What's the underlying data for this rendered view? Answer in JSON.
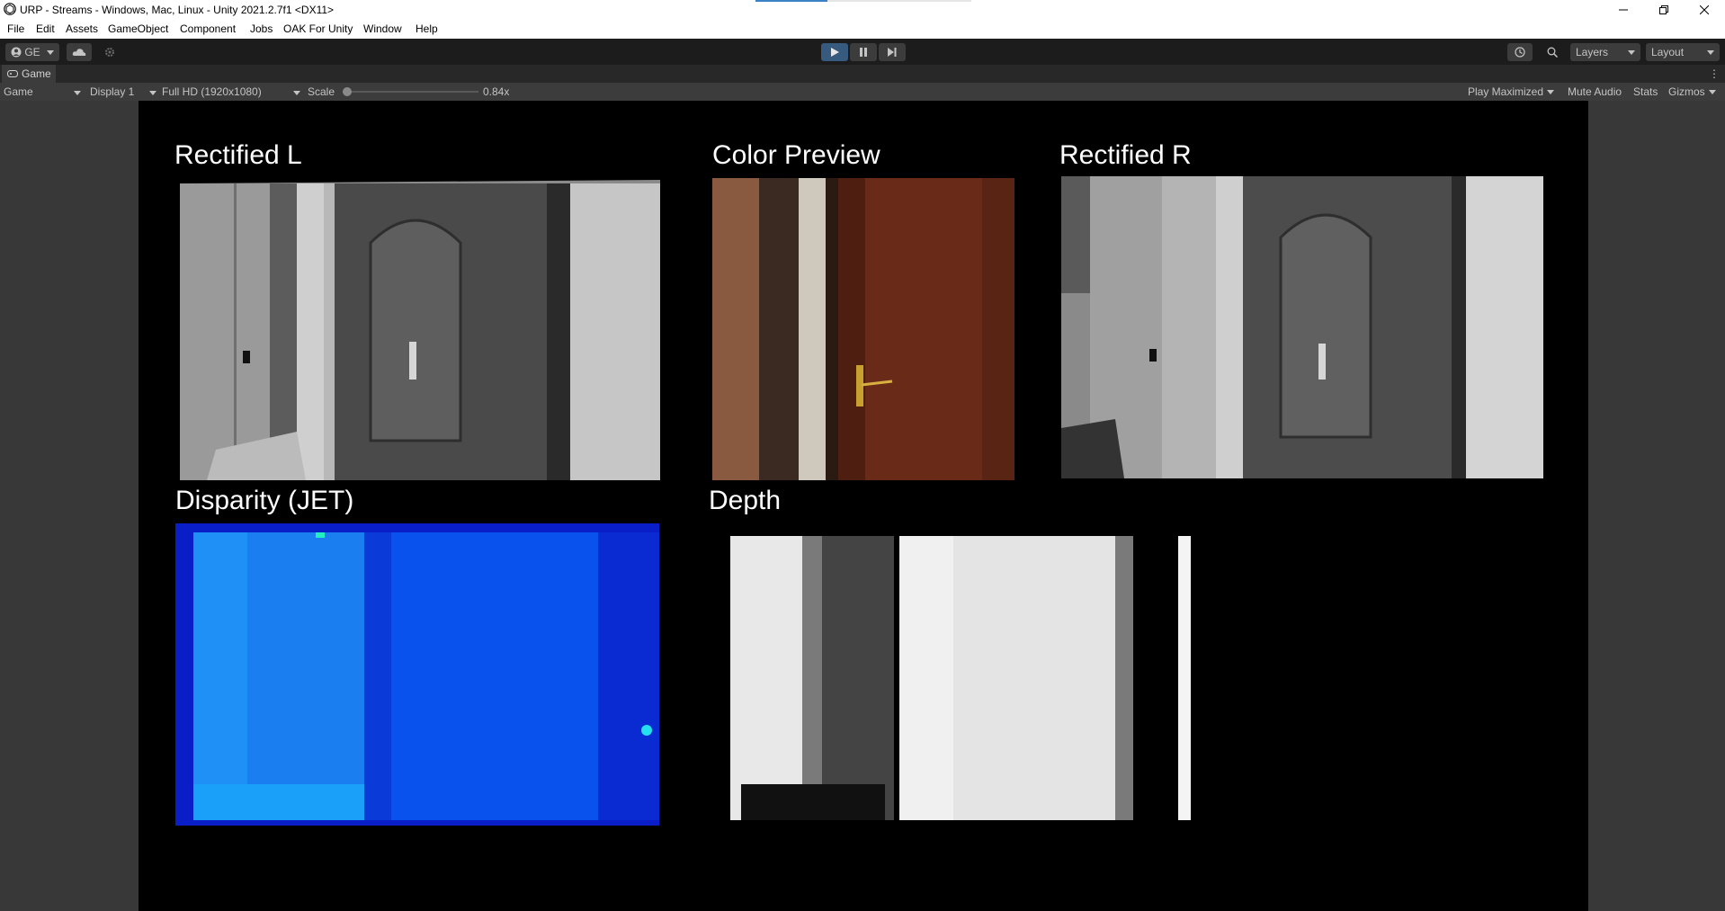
{
  "window": {
    "title": "URP - Streams - Windows, Mac, Linux - Unity 2021.2.7f1 <DX11>"
  },
  "menu": [
    "File",
    "Edit",
    "Assets",
    "GameObject",
    "Component",
    "Jobs",
    "OAK For Unity",
    "Window",
    "Help"
  ],
  "toolbar": {
    "account_label": "GE",
    "layers_label": "Layers",
    "layout_label": "Layout"
  },
  "game_tab": {
    "label": "Game"
  },
  "game_bar": {
    "view_select": "Game",
    "display_select": "Display 1",
    "resolution_select": "Full HD (1920x1080)",
    "scale_label": "Scale",
    "scale_value": "0.84x",
    "scale_fraction": 0.0,
    "play_maximized": "Play Maximized",
    "mute_audio": "Mute Audio",
    "stats": "Stats",
    "gizmos": "Gizmos"
  },
  "panels": {
    "rectified_l": "Rectified L",
    "color_preview": "Color Preview",
    "rectified_r": "Rectified R",
    "disparity": "Disparity (JET)",
    "depth": "Depth"
  },
  "colors": {
    "editor_bg": "#383838",
    "toolbar_bg": "#1c1c1c",
    "play_active": "#375a7f",
    "viewport_bg": "#000000"
  }
}
